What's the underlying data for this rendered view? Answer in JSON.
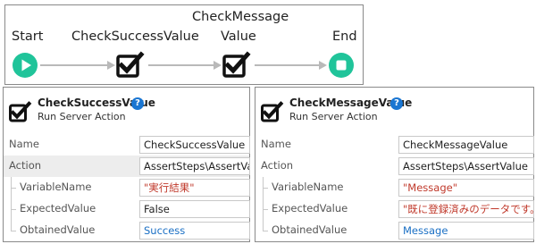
{
  "flow": {
    "nodes": [
      {
        "id": "start",
        "label": "Start",
        "icon": "play-circle-icon"
      },
      {
        "id": "check_success",
        "label": "CheckSuccessValue",
        "icon": "checkbox-check-icon"
      },
      {
        "id": "check_message",
        "label_line1": "CheckMessage",
        "label_line2": "Value",
        "icon": "checkbox-check-icon"
      },
      {
        "id": "end",
        "label": "End",
        "icon": "stop-circle-icon"
      }
    ],
    "colors": {
      "node": "#20c49a",
      "connector": "#b9b9b9"
    }
  },
  "panels": {
    "left": {
      "title": "CheckSuccessValue",
      "subtitle": "Run Server Action",
      "help": "?",
      "rows": [
        {
          "label": "Name",
          "value": "CheckSuccessValue",
          "style": "plain"
        },
        {
          "label": "Action",
          "value": "AssertSteps\\AssertValue",
          "style": "plain"
        },
        {
          "label": "VariableName",
          "value": "\"実行結果\"",
          "style": "string"
        },
        {
          "label": "ExpectedValue",
          "value": "False",
          "style": "plain"
        },
        {
          "label": "ObtainedValue",
          "value": "Success",
          "style": "link"
        }
      ]
    },
    "right": {
      "title": "CheckMessageValue",
      "subtitle": "Run Server Action",
      "help": "?",
      "rows": [
        {
          "label": "Name",
          "value": "CheckMessageValue",
          "style": "plain"
        },
        {
          "label": "Action",
          "value": "AssertSteps\\AssertValue",
          "style": "plain"
        },
        {
          "label": "VariableName",
          "value": "\"Message\"",
          "style": "string"
        },
        {
          "label": "ExpectedValue",
          "value": "\"既に登録済みのデータです。\"",
          "style": "string"
        },
        {
          "label": "ObtainedValue",
          "value": "Message",
          "style": "link"
        }
      ]
    }
  },
  "colors": {
    "help_icon": "#1a76d2",
    "string_value": "#c0392b",
    "link_value": "#1a6fc4"
  }
}
